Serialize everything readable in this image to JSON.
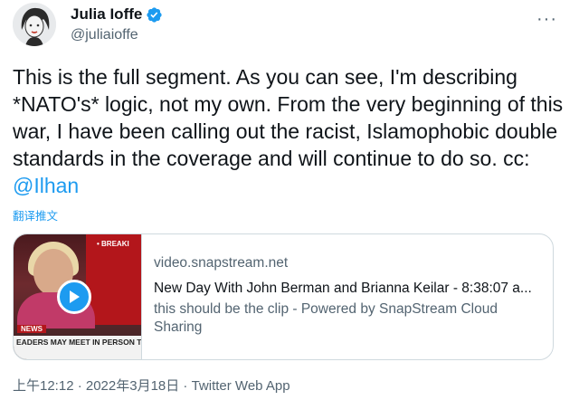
{
  "author": {
    "name": "Julia Ioffe",
    "handle": "@juliaioffe",
    "verified": true,
    "avatar_icon": "avatar-icon"
  },
  "tweet": {
    "text": "This is the full segment. As you can see, I'm describing *NATO's* logic, not my own. From the very beginning of this war, I have been calling out the racist, Islamophobic double standards in the coverage and will continue to do so. cc: ",
    "mention": "@Ilhan",
    "translate_label": "翻译推文"
  },
  "card": {
    "domain": "video.snapstream.net",
    "title": "New Day With John Berman and Brianna Keilar - 8:38:07 a...",
    "description": "this should be the clip - Powered by SnapStream Cloud Sharing",
    "thumbnail": {
      "tag_breaking": "• BREAKI",
      "tag_news": "NEWS",
      "ticker": "EADERS MAY MEET IN PERSON TO ADDRESS RUSSIA'S"
    }
  },
  "meta": {
    "timestamp": "上午12:12 · 2022年3月18日 · Twitter Web App"
  },
  "colors": {
    "accent": "#1d9bf0",
    "text": "#0f1419",
    "secondary": "#536471",
    "border": "#cfd9de"
  }
}
